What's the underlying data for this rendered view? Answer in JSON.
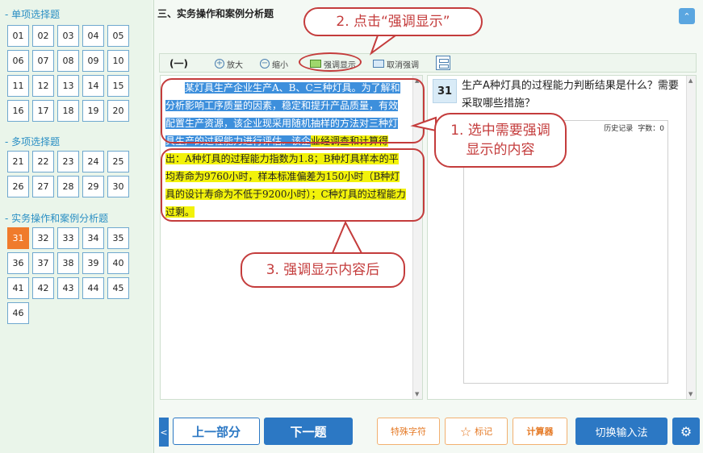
{
  "sections": [
    {
      "title": "单项选择题",
      "items": [
        "01",
        "02",
        "03",
        "04",
        "05",
        "06",
        "07",
        "08",
        "09",
        "10",
        "11",
        "12",
        "13",
        "14",
        "15",
        "16",
        "17",
        "18",
        "19",
        "20"
      ]
    },
    {
      "title": "多项选择题",
      "items": [
        "21",
        "22",
        "23",
        "24",
        "25",
        "26",
        "27",
        "28",
        "29",
        "30"
      ]
    },
    {
      "title": "实务操作和案例分析题",
      "items": [
        "31",
        "32",
        "33",
        "34",
        "35",
        "36",
        "37",
        "38",
        "39",
        "40",
        "41",
        "42",
        "43",
        "44",
        "45",
        "46"
      ]
    }
  ],
  "active_question": "31",
  "main": {
    "header": "三、实务操作和案例分析题",
    "toolbar": {
      "part": "(一)",
      "zoom_in": "放大",
      "zoom_out": "缩小",
      "highlight": "强调显示",
      "unhighlight": "取消强调"
    }
  },
  "passage": {
    "selected_text": "某灯具生产企业生产A、B、C三种灯具。为了解和分析影响工序质量的因素，稳定和提升产品质量，有效配置生产资源，该企业现采用随机抽样的方法对三种灯具生产的过程能力进行评估。该企",
    "highlighted_text": "业经调查和计算得出：A种灯具的过程能力指数为1.8；B种灯具样本的平均寿命为9760小时，样本标准偏差为150小时（B种灯具的设计寿命为不低于9200小时）；C种灯具的过程能力过剩。"
  },
  "question": {
    "number": "31",
    "text": "生产A种灯具的过程能力判断结果是什么？需要采取哪些措施？",
    "answer_toolbar": {
      "history": "历史记录",
      "count": "字数：0"
    }
  },
  "bottom": {
    "prev_part": "上一部分",
    "next": "下一题",
    "special_chars": "特殊字符",
    "mark": "标记",
    "calculator": "计算器",
    "switch_input": "切换输入法"
  },
  "annotations": {
    "step1": "1. 选中需要强调显示的内容",
    "step2": "2. 点击“强调显示”",
    "step3": "3. 强调显示内容后"
  }
}
